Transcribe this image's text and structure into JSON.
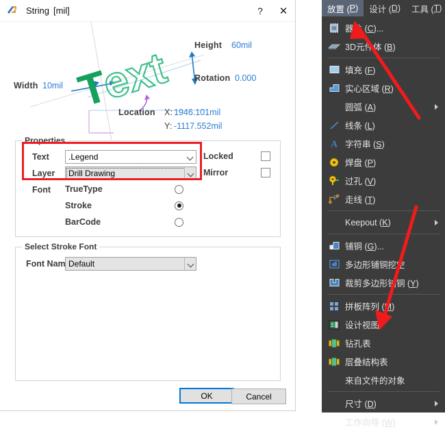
{
  "dialog": {
    "title": "String",
    "unit": "[mil]",
    "titlebar_buttons": [
      {
        "name": "help",
        "glyph": "?"
      },
      {
        "name": "close",
        "glyph": "✕"
      }
    ],
    "preview": {
      "text_glyph": "Text",
      "height_label": "Height",
      "height_value": "60mil",
      "rotation_label": "Rotation",
      "rotation_value": "0.000",
      "width_label": "Width",
      "width_value": "10mil",
      "location_label": "Location",
      "x_label": "X:",
      "x_value": "1946.101mil",
      "y_label": "Y:",
      "y_value": "-1117.552mil"
    },
    "properties": {
      "group_title": "Properties",
      "text_label": "Text",
      "text_value": ".Legend",
      "layer_label": "Layer",
      "layer_value": "Drill Drawing",
      "font_label": "Font",
      "font_options": [
        {
          "label": "TrueType",
          "selected": false
        },
        {
          "label": "Stroke",
          "selected": true
        },
        {
          "label": "BarCode",
          "selected": false
        }
      ],
      "locked_label": "Locked",
      "locked_checked": false,
      "mirror_label": "Mirror",
      "mirror_checked": false
    },
    "stroke_font": {
      "group_title": "Select Stroke Font",
      "font_name_label": "Font Name",
      "font_name_value": "Default"
    },
    "ok_label": "OK",
    "cancel_label": "Cancel"
  },
  "menu": {
    "bar": [
      {
        "label": "放置 (",
        "key": "P",
        "tail": ")",
        "active": true
      },
      {
        "label": "设计 (",
        "key": "D",
        "tail": ")",
        "active": false
      },
      {
        "label": "工具 (",
        "key": "T",
        "tail": ")",
        "active": false
      }
    ],
    "items": [
      {
        "label": "器件 (",
        "key": "C",
        "tail": ")...",
        "icon": "chip-icon",
        "sub": false,
        "sep_after": false
      },
      {
        "label": "3D元件体 (",
        "key": "B",
        "tail": ")",
        "icon": "body3d-icon",
        "sub": false,
        "sep_after": true
      },
      {
        "label": "填充 (",
        "key": "F",
        "tail": ")",
        "icon": "fill-icon",
        "sub": false,
        "sep_after": false
      },
      {
        "label": "实心区域 (",
        "key": "R",
        "tail": ")",
        "icon": "solid-region-icon",
        "sub": false,
        "sep_after": false
      },
      {
        "label": "圆弧 (",
        "key": "A",
        "tail": ")",
        "icon": "",
        "sub": true,
        "sep_after": false
      },
      {
        "label": "线条 (",
        "key": "L",
        "tail": ")",
        "icon": "line-icon",
        "sub": false,
        "sep_after": false
      },
      {
        "label": "字符串 (",
        "key": "S",
        "tail": ")",
        "icon": "string-icon",
        "sub": false,
        "sep_after": false
      },
      {
        "label": "焊盘 (",
        "key": "P",
        "tail": ")",
        "icon": "pad-icon",
        "sub": false,
        "sep_after": false
      },
      {
        "label": "过孔 (",
        "key": "V",
        "tail": ")",
        "icon": "via-icon",
        "sub": false,
        "sep_after": false
      },
      {
        "label": "走线 (",
        "key": "T",
        "tail": ")",
        "icon": "track-icon",
        "sub": false,
        "sep_after": true
      },
      {
        "label": "Keepout (",
        "key": "K",
        "tail": ")",
        "icon": "",
        "sub": true,
        "sep_after": true
      },
      {
        "label": "铺铜 (",
        "key": "G",
        "tail": ")...",
        "icon": "polygon-pour-icon",
        "sub": false,
        "sep_after": false
      },
      {
        "label": "多边形铺铜挖空",
        "key": "",
        "tail": "",
        "icon": "polygon-cutout-icon",
        "sub": false,
        "sep_after": false
      },
      {
        "label": "裁剪多边形铺铜 (",
        "key": "Y",
        "tail": ")",
        "icon": "polygon-slice-icon",
        "sub": false,
        "sep_after": true
      },
      {
        "label": "拼板阵列 (",
        "key": "M",
        "tail": ")",
        "icon": "panel-array-icon",
        "sub": false,
        "sep_after": false
      },
      {
        "label": "设计视图",
        "key": "",
        "tail": "",
        "icon": "design-view-icon",
        "sub": false,
        "sep_after": false
      },
      {
        "label": "钻孔表",
        "key": "",
        "tail": "",
        "icon": "drill-table-icon",
        "sub": false,
        "sep_after": false
      },
      {
        "label": "层叠结构表",
        "key": "",
        "tail": "",
        "icon": "layer-stack-table-icon",
        "sub": false,
        "sep_after": false
      },
      {
        "label": "来自文件的对象",
        "key": "",
        "tail": "",
        "icon": "",
        "sub": false,
        "sep_after": true
      },
      {
        "label": "尺寸 (",
        "key": "D",
        "tail": ")",
        "icon": "",
        "sub": true,
        "sep_after": false
      },
      {
        "label": "工作向导 (",
        "key": "W",
        "tail": ")",
        "icon": "",
        "sub": true,
        "sep_after": false
      }
    ]
  },
  "annotations": {
    "highlight_color": "#ee1c23",
    "arrow_color": "#f11b1b",
    "arrow_count": 2
  }
}
